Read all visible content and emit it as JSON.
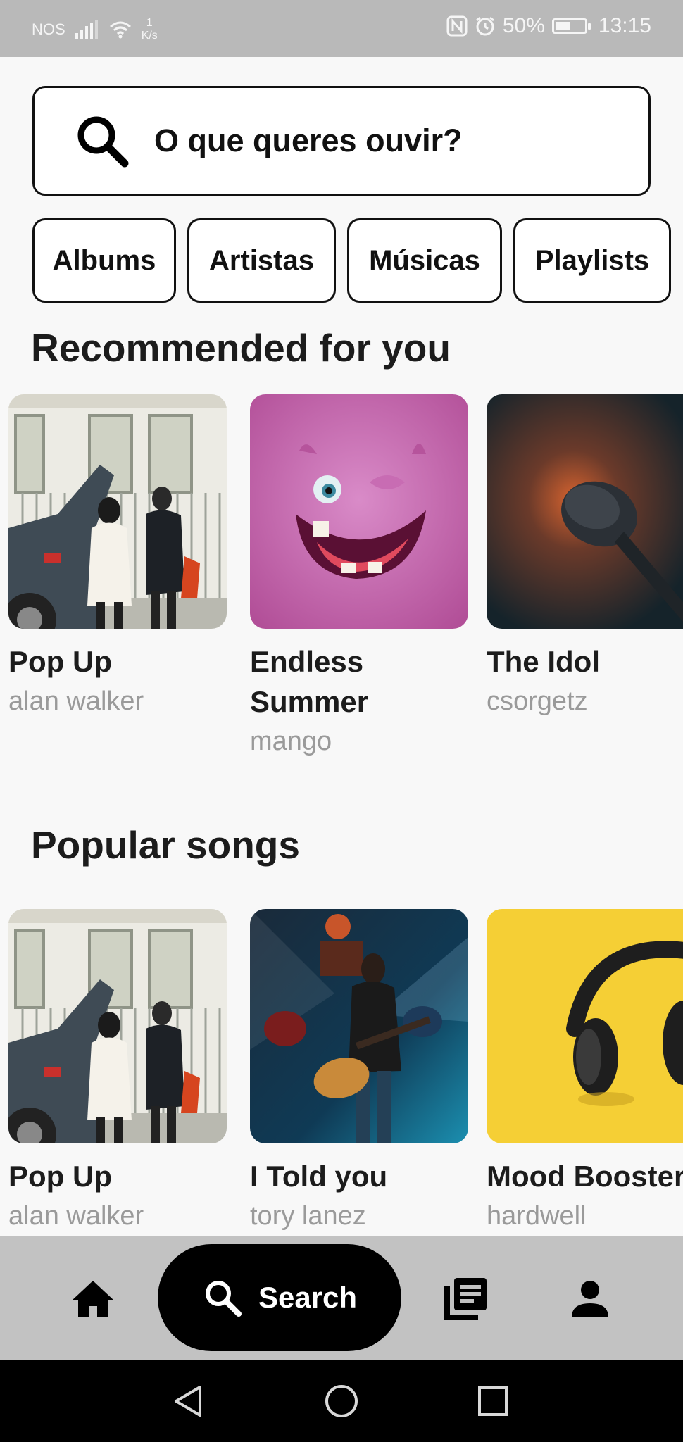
{
  "status_bar": {
    "carrier": "NOS",
    "net_speed_value": "1",
    "net_speed_unit": "K/s",
    "battery": "50%",
    "battery_level": 0.5,
    "time": "13:15"
  },
  "search": {
    "placeholder": "O que queres ouvir?",
    "icon": "search-icon"
  },
  "filters": [
    "Albums",
    "Artistas",
    "Músicas",
    "Playlists"
  ],
  "recommended": {
    "title": "Recommended for you",
    "items": [
      {
        "title": "Pop Up",
        "artist": "alan walker"
      },
      {
        "title": "Endless Summer",
        "artist": "mango"
      },
      {
        "title": "The Idol",
        "artist": "csorgetz"
      }
    ]
  },
  "popular": {
    "title": "Popular songs",
    "items": [
      {
        "title": "Pop Up",
        "artist": "alan walker"
      },
      {
        "title": "I Told you",
        "artist": "tory lanez"
      },
      {
        "title": "Mood Booster",
        "artist": "hardwell"
      }
    ]
  },
  "bottom_nav": {
    "search_label": "Search",
    "items": [
      "home-icon",
      "search-icon",
      "library-icon",
      "profile-icon"
    ]
  },
  "colors": {
    "accent": "#000000",
    "background": "#f8f8f8",
    "nav_background": "#c2c2c2",
    "status_bar": "#b9b9b9",
    "muted_text": "#9a9a9a"
  }
}
